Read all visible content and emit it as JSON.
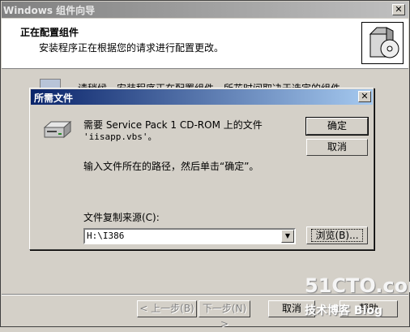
{
  "wizard": {
    "title": "Windows 组件向导",
    "header_title": "正在配置组件",
    "header_subtitle": "安装程序正在根据您的请求进行配置更改。",
    "body_text": "请稍候，安装程序正在配置组件。所花时间取决于选定的组件。",
    "buttons": {
      "back": "< 上一步(B)",
      "next": "下一步(N) >",
      "cancel": "取消",
      "help": "帮助"
    }
  },
  "dialog": {
    "title": "所需文件",
    "message_line1": "需要 Service Pack 1 CD-ROM 上的文件",
    "message_line2": "'iisapp.vbs'。",
    "instruction": "输入文件所在的路径，然后单击“确定”。",
    "ok": "确定",
    "cancel": "取消",
    "source_label": "文件复制来源(C):",
    "source_value": "H:\\I386",
    "browse": "浏览(B)..."
  },
  "watermark": {
    "top": "51CTO.com",
    "bottom": "技术博客  Blog"
  }
}
